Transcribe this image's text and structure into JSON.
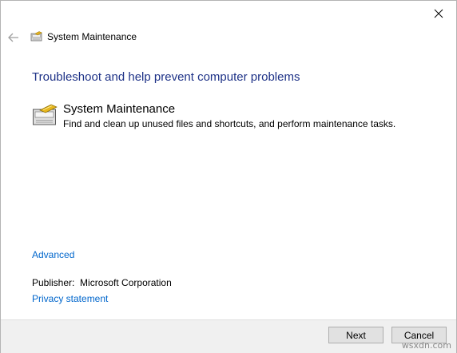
{
  "nav": {
    "title": "System Maintenance"
  },
  "heading": "Troubleshoot and help prevent computer problems",
  "item": {
    "title": "System Maintenance",
    "description": "Find and clean up unused files and shortcuts, and perform maintenance tasks.",
    "icon": "system-maintenance-icon"
  },
  "links": {
    "advanced": "Advanced",
    "privacy": "Privacy statement"
  },
  "publisher": {
    "label": "Publisher:",
    "value": "Microsoft Corporation"
  },
  "buttons": {
    "next": "Next",
    "cancel": "Cancel"
  },
  "watermark": "wsxdn.com",
  "colors": {
    "heading": "#1e3287",
    "link": "#0066cc",
    "footer_bg": "#f0f0f0"
  }
}
